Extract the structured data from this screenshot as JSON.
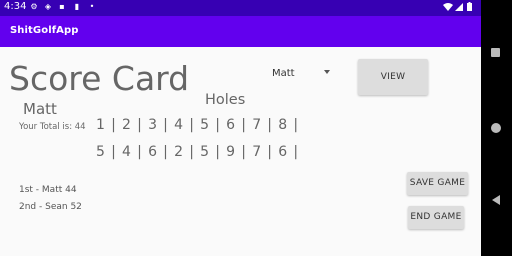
{
  "status_bar": {
    "time": "4:34",
    "icons": [
      "settings-icon",
      "shield-icon",
      "sim-icon",
      "card-icon",
      "dot-icon",
      "wifi-icon",
      "signal-icon",
      "battery-icon"
    ]
  },
  "app_bar": {
    "title": "ShitGolfApp"
  },
  "score_card": {
    "title": "Score Card",
    "player_name": "Matt",
    "total_text": "Your Total is: 44",
    "holes_label": "Holes",
    "hole_numbers": [
      "1",
      "2",
      "3",
      "4",
      "5",
      "6",
      "7",
      "8"
    ],
    "scores": [
      "5",
      "4",
      "6",
      "2",
      "5",
      "9",
      "7",
      "6"
    ],
    "separator": "|"
  },
  "player_select": {
    "selected": "Matt"
  },
  "buttons": {
    "view": "VIEW",
    "save_game": "SAVE GAME",
    "end_game": "END GAME"
  },
  "leaderboard": {
    "entries": [
      "1st - Matt 44",
      "2nd - Sean 52"
    ]
  },
  "colors": {
    "status_bar": "#3700b3",
    "app_bar": "#6200ee",
    "background": "#fafafa",
    "button": "#dddddd",
    "text": "#666666"
  }
}
